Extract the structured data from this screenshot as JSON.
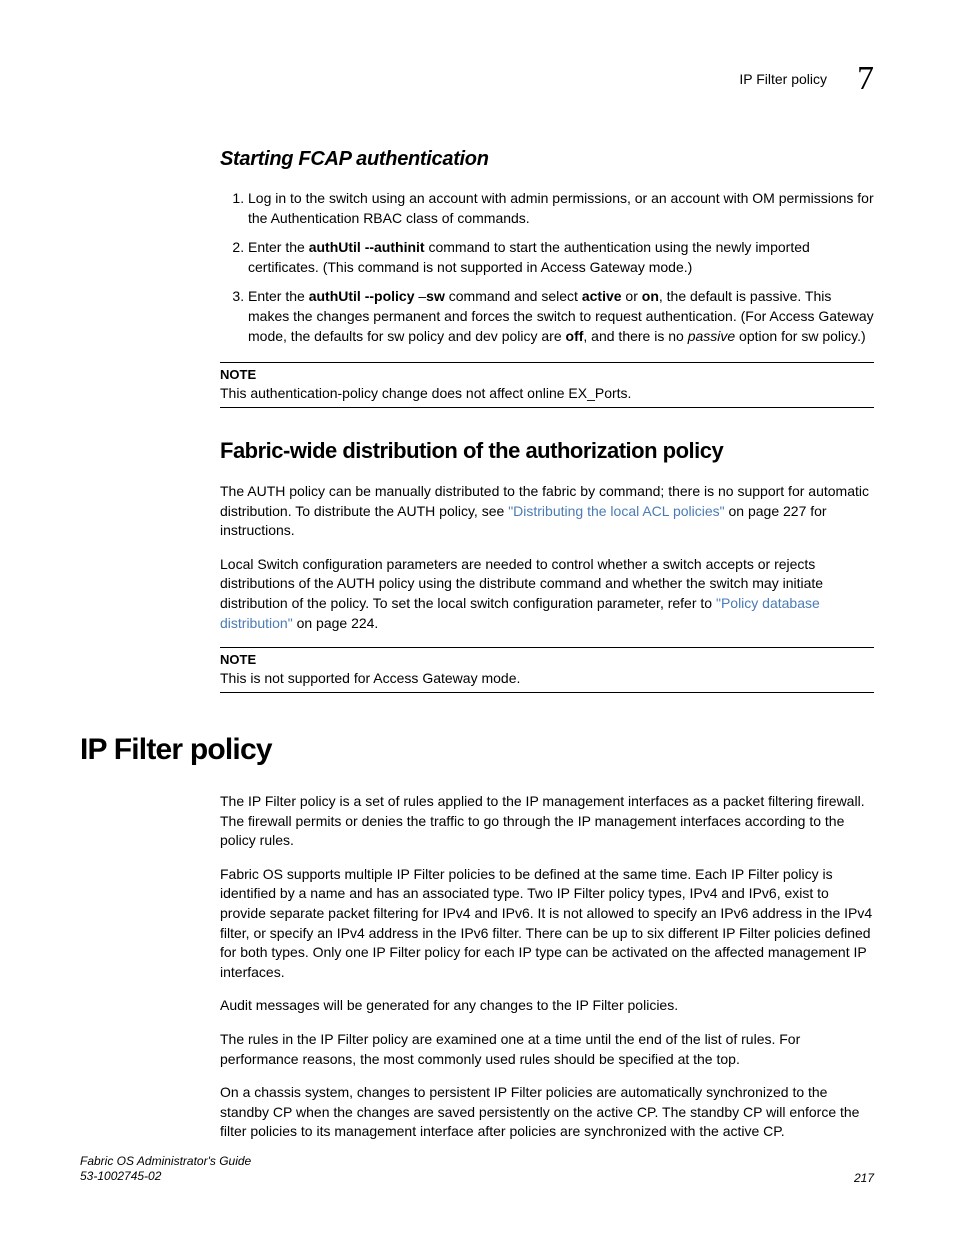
{
  "header": {
    "title": "IP Filter policy",
    "chapter": "7"
  },
  "section1": {
    "title": "Starting FCAP authentication",
    "step1": "Log in to the switch using an account with admin permissions, or an account with OM permissions for the Authentication RBAC class of commands.",
    "step2_a": "Enter the ",
    "step2_cmd": "authUtil  --authinit",
    "step2_b": " command to start the authentication using the newly imported certificates. (This command is not supported in Access Gateway mode.)",
    "step3_a": "Enter the ",
    "step3_cmd1": "authUtil  --policy",
    "step3_b": " –",
    "step3_cmd2": "sw",
    "step3_c": " command and select ",
    "step3_cmd3": "active",
    "step3_d": " or ",
    "step3_cmd4": "on",
    "step3_e": ", the default is passive. This makes the changes permanent and forces the switch to request authentication. (For Access Gateway mode, the defaults for sw policy and dev policy are ",
    "step3_cmd5": "off",
    "step3_f": ", and there is no ",
    "step3_i": "passive",
    "step3_g": " option for sw policy.)"
  },
  "note1": {
    "label": "NOTE",
    "text": "This authentication-policy change does not affect online EX_Ports."
  },
  "section2": {
    "title": "Fabric-wide distribution of the authorization policy",
    "p1_a": "The AUTH policy can be manually distributed to the fabric by command; there is no support for automatic distribution. To distribute the AUTH policy, see ",
    "p1_link": "\"Distributing the local ACL policies\"",
    "p1_b": " on page 227 for instructions.",
    "p2_a": "Local Switch configuration parameters are needed to control whether a switch accepts or rejects distributions of the AUTH policy using the distribute command and whether the switch may initiate distribution of the policy. To set the local switch configuration parameter, refer to ",
    "p2_link": "\"Policy database distribution\"",
    "p2_b": " on page 224."
  },
  "note2": {
    "label": "NOTE",
    "text": "This is not supported for Access Gateway mode."
  },
  "main": {
    "heading": "IP Filter policy",
    "p1": "The IP Filter policy is a set of rules applied to the IP management interfaces as a packet filtering firewall. The firewall permits or denies the traffic to go through the IP management interfaces according to the policy rules.",
    "p2": "Fabric OS supports multiple IP Filter policies to be defined at the same time. Each IP Filter policy is identified by a name and has an associated type. Two IP Filter policy types, IPv4 and IPv6, exist to provide separate packet filtering for IPv4 and IPv6. It is not allowed to specify an IPv6 address in the IPv4 filter, or specify an IPv4 address in the IPv6 filter. There can be up to six different IP Filter policies defined for both types. Only one IP Filter policy for each IP type can be activated on the affected management IP interfaces.",
    "p3": "Audit messages will be generated for any changes to the IP Filter policies.",
    "p4": "The rules in the IP Filter policy are examined one at a time until the end of the list of rules. For performance reasons, the most commonly used rules should be specified at the top.",
    "p5": "On a chassis system, changes to persistent IP Filter policies are automatically synchronized to the standby CP when the changes are saved persistently on the active CP. The standby CP will enforce the filter policies to its management interface after policies are synchronized with the active CP."
  },
  "footer": {
    "guide": "Fabric OS Administrator's Guide",
    "docnum": "53-1002745-02",
    "page": "217"
  }
}
